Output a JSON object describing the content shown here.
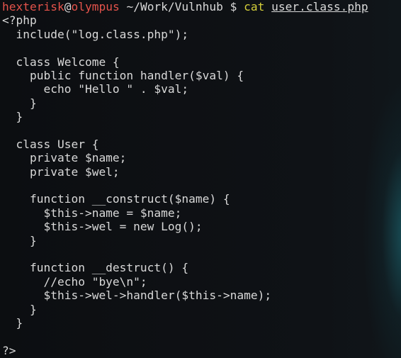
{
  "window": {
    "accent_colors": {
      "prompt_user_host": "#e5534b",
      "command": "#d4cf3a",
      "text": "#d9d9d9",
      "background": "#0e1013",
      "glow": "#2296a5"
    }
  },
  "prompt": {
    "user": "hexterisk",
    "at": "@",
    "host": "olympus",
    "path": "~/Work/Vulnhub",
    "symbol": "$",
    "command": "cat",
    "argument": "user.class.php"
  },
  "code_lines": [
    "<?php",
    "  include(\"log.class.php\");",
    "",
    "  class Welcome {",
    "    public function handler($val) {",
    "      echo \"Hello \" . $val;",
    "    }",
    "  }",
    "",
    "  class User {",
    "    private $name;",
    "    private $wel;",
    "",
    "    function __construct($name) {",
    "      $this->name = $name;",
    "      $this->wel = new Log();",
    "    }",
    "",
    "    function __destruct() {",
    "      //echo \"bye\\n\";",
    "      $this->wel->handler($this->name);",
    "    }",
    "  }",
    "",
    "?>"
  ]
}
